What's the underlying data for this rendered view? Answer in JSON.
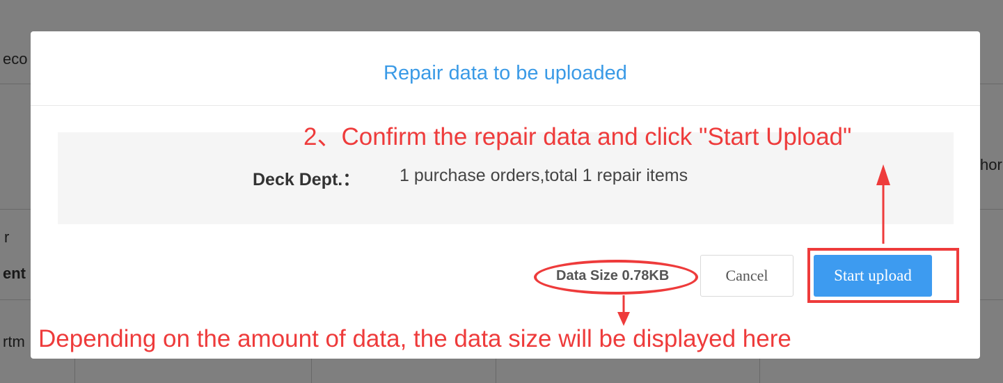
{
  "background": {
    "fragments": [
      "eco",
      "hor",
      "r",
      "ent",
      "rtm"
    ]
  },
  "dialog": {
    "title": "Repair data to be uploaded",
    "summary": {
      "label": "Deck Dept.：",
      "value": "1 purchase orders,total 1 repair items"
    },
    "data_size": "Data Size 0.78KB",
    "cancel_label": "Cancel",
    "start_label": "Start upload"
  },
  "annotations": {
    "step_text": "2、Confirm the repair data and click \"Start Upload\"",
    "size_note": "Depending on the amount of data, the data size will be displayed here",
    "color": "#ee3b3b"
  },
  "colors": {
    "title": "#3a9ae6",
    "primary_button": "#3d9bf0",
    "overlay": "rgba(0,0,0,0.5)"
  }
}
